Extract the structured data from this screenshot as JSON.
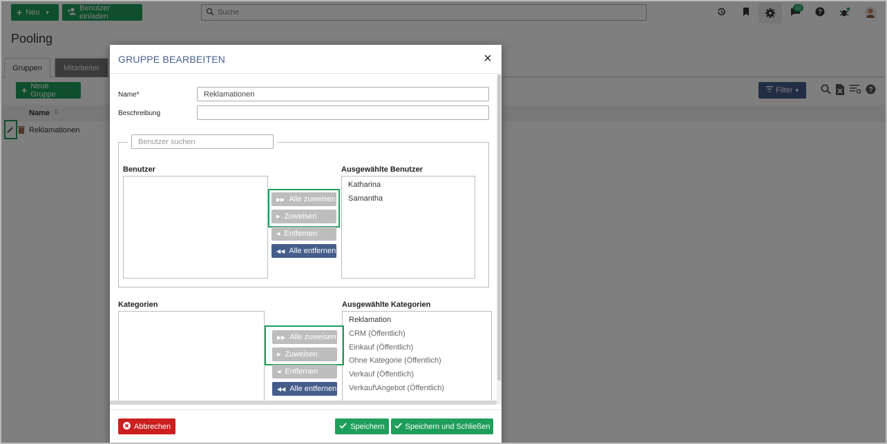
{
  "topbar": {
    "new_label": "Neu",
    "invite_label": "Benutzer einladen",
    "search_placeholder": "Suche",
    "notification_count": "10"
  },
  "page": {
    "title": "Pooling",
    "tabs": [
      {
        "label": "Gruppen",
        "active": true
      },
      {
        "label": "Mitarbeiter",
        "active": false
      }
    ],
    "new_group_label": "Neue Gruppe",
    "filter_label": "Filter",
    "grid": {
      "column_name": "Name",
      "rows": [
        {
          "name": "Reklamationen"
        }
      ]
    }
  },
  "modal": {
    "title": "GRUPPE BEARBEITEN",
    "name_label": "Name*",
    "name_value": "Reklamationen",
    "description_label": "Beschreibung",
    "description_value": "",
    "user_search_placeholder": "Benutzer suchen",
    "users_label": "Benutzer",
    "selected_users_label": "Ausgewählte Benutzer",
    "selected_users": [
      "Katharina",
      "Samantha"
    ],
    "categories_label": "Kategorien",
    "selected_categories_label": "Ausgewählte Kategorien",
    "selected_categories": [
      "Reklamation",
      "CRM (Öffentlich)",
      "Einkauf (Öffentlich)",
      "Ohne Kategorie (Öffentlich)",
      "Verkauf (Öffentlich)",
      "Verkauf\\Angebot (Öffentlich)"
    ],
    "buttons": {
      "assign_all": "Alle zuweisen",
      "assign": "Zuweisen",
      "remove": "Entfernen",
      "remove_all": "Alle entfernen"
    },
    "footer": {
      "cancel": "Abbrechen",
      "save": "Speichern",
      "save_close": "Speichern und Schließen"
    }
  },
  "colors": {
    "primary_green": "#1e9e5a",
    "accent_blue": "#455d8a",
    "danger_red": "#cc1f1f"
  }
}
